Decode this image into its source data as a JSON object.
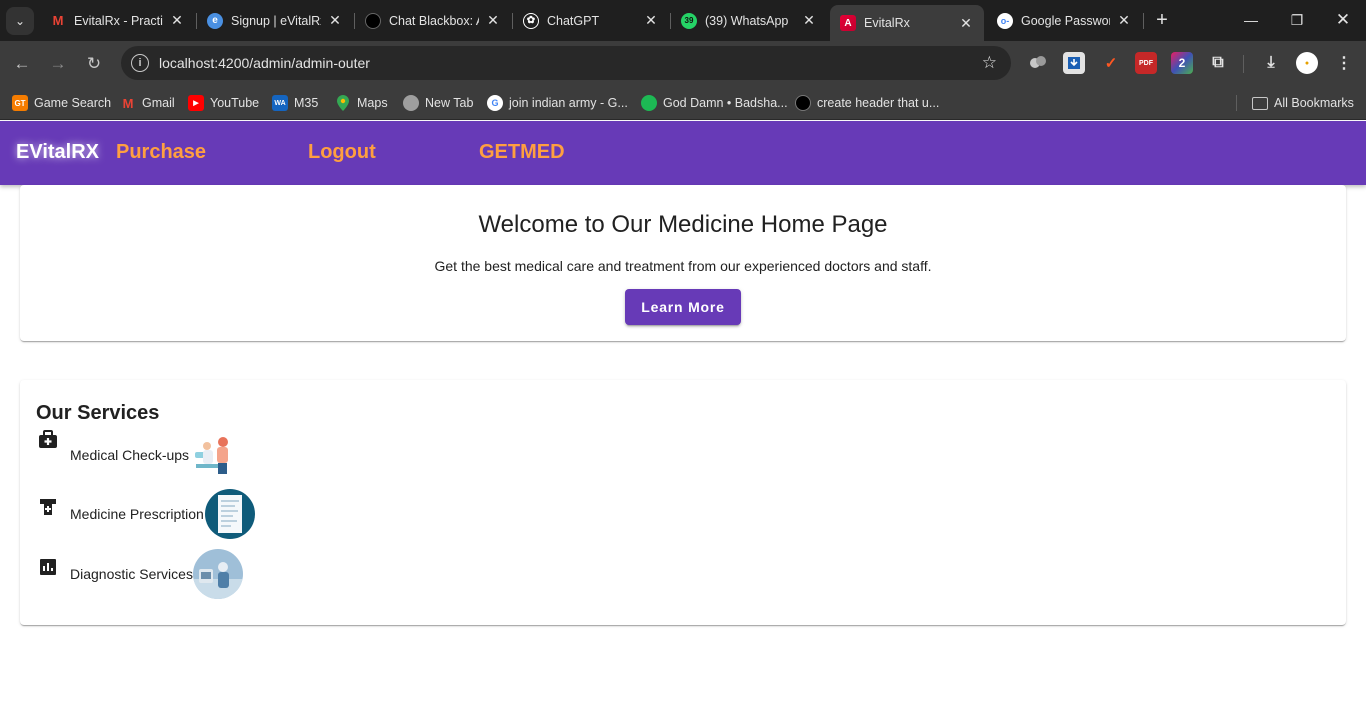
{
  "browser": {
    "tabs": [
      {
        "title": "EvitalRx - Practic",
        "icon": "gmail-icon",
        "color": "#ea4335"
      },
      {
        "title": "Signup | eVitalRx",
        "icon": "evitalrx-icon",
        "color": "#4a90e2"
      },
      {
        "title": "Chat Blackbox: AI",
        "icon": "blackbox-icon",
        "color": "#111111"
      },
      {
        "title": "ChatGPT",
        "icon": "openai-icon",
        "color": "#ffffff"
      },
      {
        "title": "(39) WhatsApp",
        "icon": "whatsapp-icon",
        "color": "#25d366"
      },
      {
        "title": "EvitalRx",
        "icon": "angular-icon",
        "color": "#dd0031"
      },
      {
        "title": "Google Passwords",
        "icon": "google-password-icon",
        "color": "#4285f4"
      }
    ],
    "whatsapp_badge": "39",
    "url": "localhost:4200/admin/admin-outer",
    "bookmarks": [
      {
        "label": "Game Search",
        "icon": "gt-icon",
        "icon_text": "GT"
      },
      {
        "label": "Gmail",
        "icon": "gmail-icon",
        "icon_text": "M"
      },
      {
        "label": "YouTube",
        "icon": "youtube-icon",
        "icon_text": "▶"
      },
      {
        "label": "M35",
        "icon": "wa-icon",
        "icon_text": "WA"
      },
      {
        "label": "Maps",
        "icon": "maps-icon",
        "icon_text": ""
      },
      {
        "label": "New Tab",
        "icon": "globe-icon",
        "icon_text": ""
      },
      {
        "label": "join indian army - G...",
        "icon": "google-icon",
        "icon_text": "G"
      },
      {
        "label": "God Damn • Badsha...",
        "icon": "spotify-icon",
        "icon_text": ""
      },
      {
        "label": "create header that u...",
        "icon": "blackbox-icon",
        "icon_text": ""
      }
    ],
    "all_bookmarks": "All Bookmarks",
    "extensions": [
      {
        "icon": "puzzle-blob-icon",
        "color": "#5f5f5f",
        "text": ""
      },
      {
        "icon": "download-box-icon",
        "color": "#e3e3e3",
        "text": ""
      },
      {
        "icon": "vivaldi-icon",
        "color": "#ff5722",
        "text": "✓"
      },
      {
        "icon": "pdf-icon",
        "color": "#e53935",
        "text": "PDF"
      },
      {
        "icon": "number-two-icon",
        "color": "#8e44ad",
        "text": "2"
      }
    ]
  },
  "app": {
    "brand": "EVitalRX",
    "nav": [
      "Purchase",
      "Logout",
      "GETMED"
    ],
    "hero": {
      "title": "Welcome to Our Medicine Home Page",
      "subtitle": "Get the best medical care and treatment from our experienced doctors and staff.",
      "cta": "Learn More"
    },
    "services": {
      "title": "Our Services",
      "items": [
        {
          "label": "Medical Check-ups",
          "icon": "medical-bag-icon"
        },
        {
          "label": "Medicine Prescription",
          "icon": "prescription-icon"
        },
        {
          "label": "Diagnostic Services",
          "icon": "chart-icon"
        }
      ]
    }
  },
  "colors": {
    "primary": "#673ab7",
    "nav_link": "#ff9f40",
    "browser_dark": "#1f1f1f"
  }
}
